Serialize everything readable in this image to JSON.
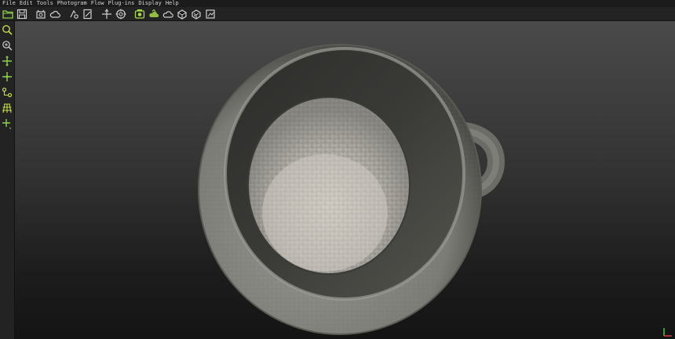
{
  "menubar": {
    "items": [
      {
        "label": "File"
      },
      {
        "label": "Edit"
      },
      {
        "label": "Tools"
      },
      {
        "label": "Photogram"
      },
      {
        "label": "Flow"
      },
      {
        "label": "Plug-ins"
      },
      {
        "label": "Display"
      },
      {
        "label": "Help"
      }
    ]
  },
  "toolbar": {
    "buttons": [
      {
        "icon": "open-folder-icon",
        "color": "#8fd14f"
      },
      {
        "icon": "save-icon",
        "color": "#cfcfcf"
      },
      {
        "icon": "import-photos-icon",
        "color": "#cfcfcf"
      },
      {
        "icon": "cloud-icon",
        "color": "#cfcfcf"
      },
      {
        "icon": "point-tool-icon",
        "color": "#cfcfcf"
      },
      {
        "icon": "edit-image-icon",
        "color": "#cfcfcf"
      },
      {
        "icon": "pointer-icon",
        "color": "#cfcfcf"
      },
      {
        "icon": "target-icon",
        "color": "#cfcfcf"
      },
      {
        "icon": "compute-photos-icon",
        "color": "#a8d84c"
      },
      {
        "icon": "compute-cloud-icon",
        "color": "#a8d84c"
      },
      {
        "icon": "mesh-cloud-icon",
        "color": "#cfcfcf"
      },
      {
        "icon": "mesh-icon",
        "color": "#cfcfcf"
      },
      {
        "icon": "textured-mesh-icon",
        "color": "#cfcfcf"
      },
      {
        "icon": "export-icon",
        "color": "#cfcfcf"
      }
    ]
  },
  "lefttools": {
    "buttons": [
      {
        "icon": "zoom-icon",
        "color": "#c8d84c"
      },
      {
        "icon": "zoom-extents-icon",
        "color": "#cfcfcf"
      },
      {
        "icon": "pan-icon",
        "color": "#8fd14f"
      },
      {
        "icon": "orbit-icon",
        "color": "#8fd14f"
      },
      {
        "icon": "measure-icon",
        "color": "#c8d84c"
      },
      {
        "icon": "grid-icon",
        "color": "#c8d84c"
      },
      {
        "icon": "add-point-icon",
        "color": "#8fd14f"
      }
    ]
  },
  "viewport": {
    "object": "ceramic-cup-model"
  }
}
